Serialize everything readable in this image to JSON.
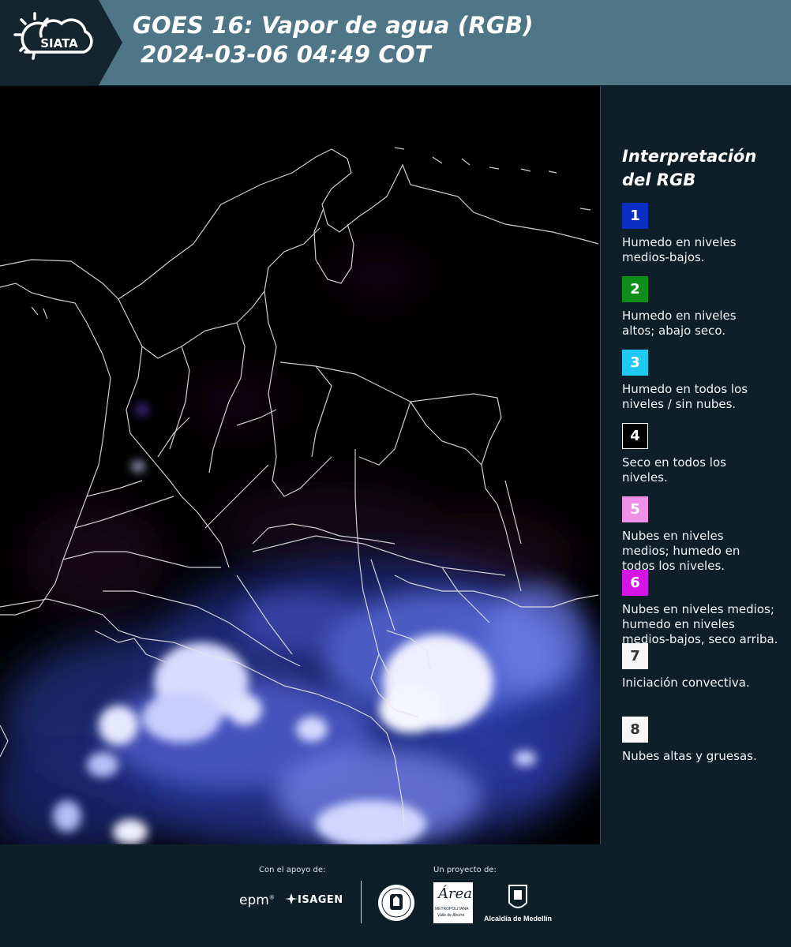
{
  "header": {
    "logo_text": "SIATA",
    "title_line1": "GOES 16: Vapor de agua (RGB)",
    "title_line2": "2024-03-06 04:49 COT"
  },
  "legend": {
    "title_line1": "Interpretación",
    "title_line2": "del RGB",
    "items": [
      {
        "number": "1",
        "color": "#0b2fc4",
        "text_color": "#ffffff",
        "line1": "Humedo en niveles",
        "line2": "medios-bajos.",
        "line3": ""
      },
      {
        "number": "2",
        "color": "#0f8f18",
        "text_color": "#ffffff",
        "line1": "Humedo en niveles",
        "line2": "altos; abajo seco.",
        "line3": ""
      },
      {
        "number": "3",
        "color": "#1ec8f0",
        "text_color": "#ffffff",
        "line1": "Humedo en todos los",
        "line2": "niveles / sin nubes.",
        "line3": ""
      },
      {
        "number": "4",
        "color": "#000000",
        "text_color": "#ffffff",
        "line1": "Seco en todos los",
        "line2": "niveles.",
        "line3": ""
      },
      {
        "number": "5",
        "color": "#ef8fe8",
        "text_color": "#ffffff",
        "line1": "Nubes en niveles",
        "line2": "medios; humedo en",
        "line3": "todos los niveles."
      },
      {
        "number": "6",
        "color": "#d414e6",
        "text_color": "#ffffff",
        "line1": "Nubes en niveles medios;",
        "line2": "humedo en niveles",
        "line3": "medios-bajos, seco arriba."
      },
      {
        "number": "7",
        "color": "#f6f6f6",
        "text_color": "#333333",
        "line1": "Iniciación convectiva.",
        "line2": "",
        "line3": ""
      },
      {
        "number": "8",
        "color": "#f6f6f6",
        "text_color": "#333333",
        "line1": "Nubes altas y gruesas.",
        "line2": "",
        "line3": ""
      }
    ]
  },
  "footer": {
    "support_label": "Con el apoyo de:",
    "project_label": "Un proyecto de:",
    "epm_text": "epm",
    "isagen_text": "ISAGEN",
    "area_text": "Área",
    "area_sub1": "METROPOLITANA",
    "area_sub2": "Valle de Aburrá",
    "alcaldia_text": "Alcaldía de Medellín"
  }
}
